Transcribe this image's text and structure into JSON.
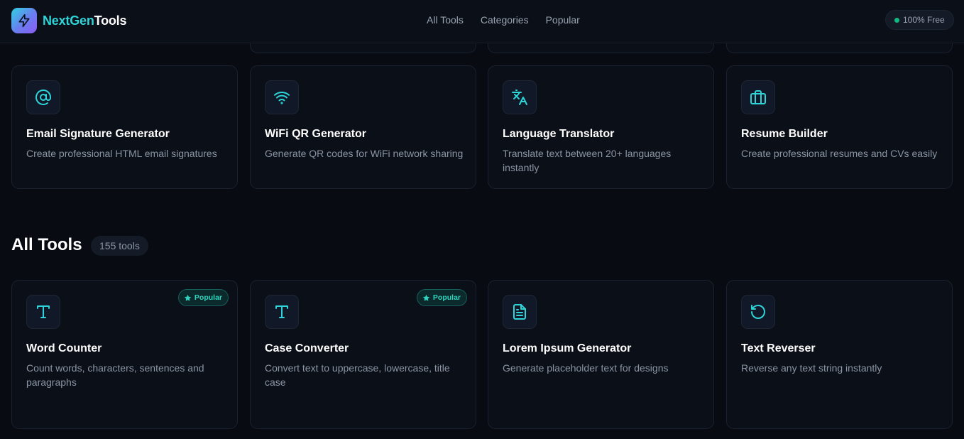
{
  "brand": {
    "name_a": "NextGen",
    "name_b": "Tools",
    "icon": "lightning-icon"
  },
  "nav": [
    {
      "label": "All Tools"
    },
    {
      "label": "Categories"
    },
    {
      "label": "Popular"
    }
  ],
  "free_badge": "100% Free",
  "featured_cards": [
    {
      "title": "Email Signature Generator",
      "description": "Create professional HTML email signatures",
      "icon": "at-sign-icon"
    },
    {
      "title": "WiFi QR Generator",
      "description": "Generate QR codes for WiFi network sharing",
      "icon": "wifi-icon"
    },
    {
      "title": "Language Translator",
      "description": "Translate text between 20+ languages instantly",
      "icon": "translate-icon"
    },
    {
      "title": "Resume Builder",
      "description": "Create professional resumes and CVs easily",
      "icon": "briefcase-icon"
    }
  ],
  "all_tools": {
    "title": "All Tools",
    "count": "155 tools",
    "popular_label": "Popular",
    "cards": [
      {
        "title": "Word Counter",
        "description": "Count words, characters, sentences and paragraphs",
        "icon": "text-t-icon",
        "popular": true
      },
      {
        "title": "Case Converter",
        "description": "Convert text to uppercase, lowercase, title case",
        "icon": "text-t-icon",
        "popular": true
      },
      {
        "title": "Lorem Ipsum Generator",
        "description": "Generate placeholder text for designs",
        "icon": "document-icon",
        "popular": false
      },
      {
        "title": "Text Reverser",
        "description": "Reverse any text string instantly",
        "icon": "rotate-ccw-icon",
        "popular": false
      }
    ]
  },
  "colors": {
    "accent": "#2dd4d8",
    "background": "#080b12",
    "card": "#0b0f17",
    "free_dot": "#10b981"
  }
}
